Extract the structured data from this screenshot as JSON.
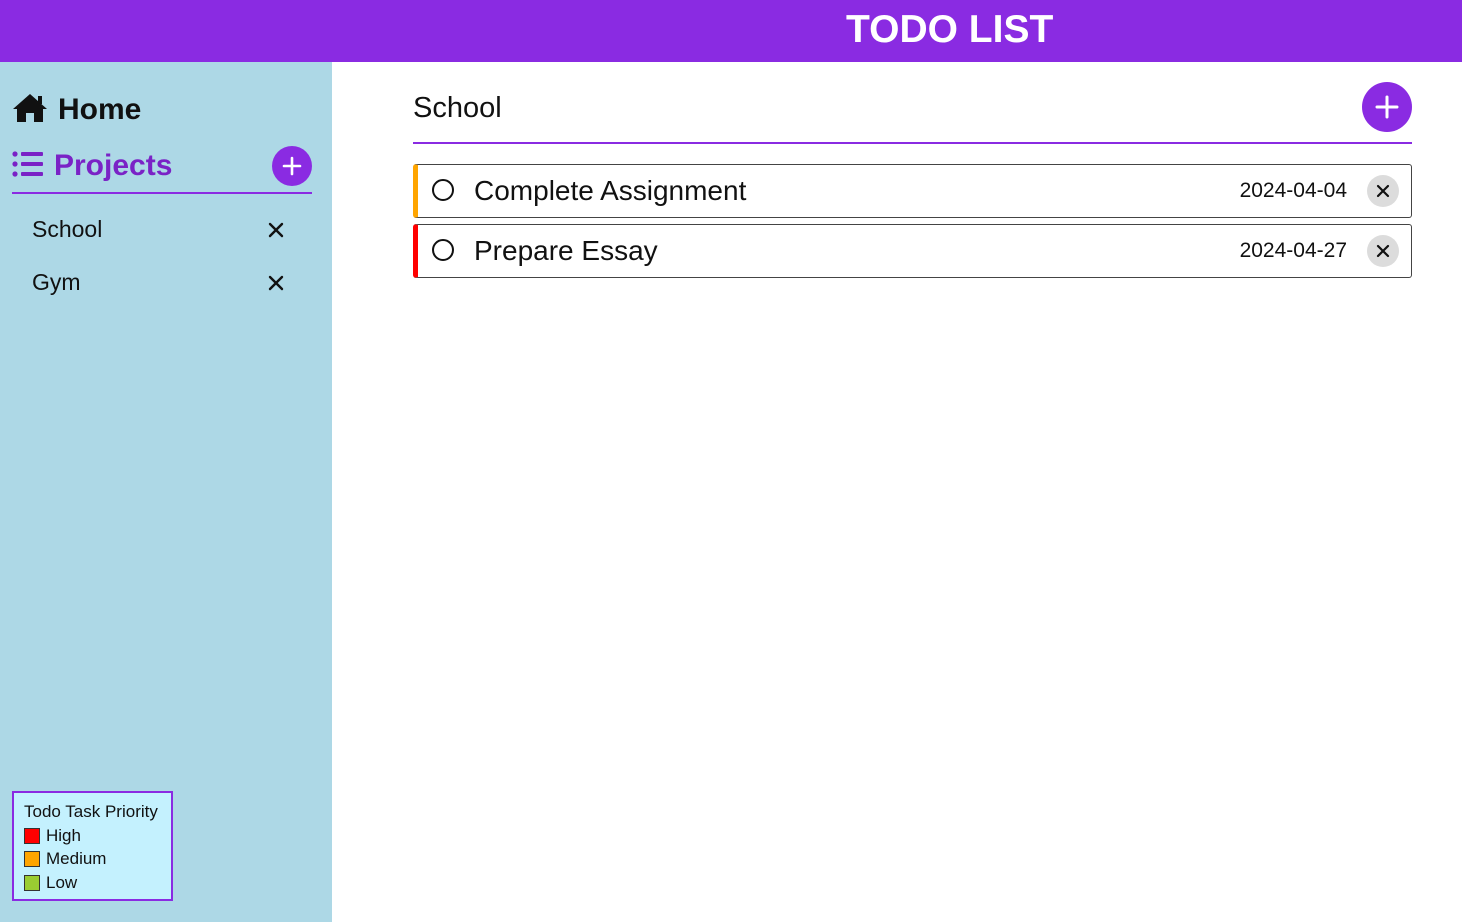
{
  "header": {
    "title": "TODO LIST"
  },
  "sidebar": {
    "home_label": "Home",
    "projects_label": "Projects",
    "projects": [
      {
        "name": "School"
      },
      {
        "name": "Gym"
      }
    ]
  },
  "legend": {
    "title": "Todo Task Priority",
    "items": [
      {
        "label": "High",
        "color": "#ff0000"
      },
      {
        "label": "Medium",
        "color": "#ffa500"
      },
      {
        "label": "Low",
        "color": "#9acd32"
      }
    ]
  },
  "main": {
    "project_title": "School",
    "todos": [
      {
        "title": "Complete Assignment",
        "date": "2024-04-04",
        "priority_color": "#ffa500"
      },
      {
        "title": "Prepare Essay",
        "date": "2024-04-27",
        "priority_color": "#ff0000"
      }
    ]
  },
  "colors": {
    "accent": "#8a2be2",
    "sidebar_bg": "#add8e6",
    "legend_bg": "#c4f1fe"
  }
}
